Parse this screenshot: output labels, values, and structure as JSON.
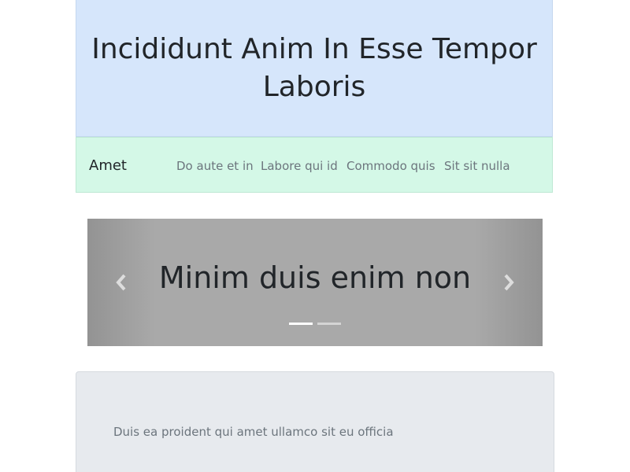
{
  "header": {
    "title": "Incididunt Anim In Esse Tempor Laboris"
  },
  "navbar": {
    "brand": "Amet",
    "items": [
      {
        "label": "Do aute et in"
      },
      {
        "label": "Labore qui id"
      },
      {
        "label": "Commodo quis"
      },
      {
        "label": "Sit sit nulla"
      }
    ]
  },
  "carousel": {
    "slide_title": "Minim duis enim non",
    "prev_icon": "chevron-left-icon",
    "next_icon": "chevron-right-icon",
    "indicator_count": 2,
    "active_indicator": 1
  },
  "jumbotron": {
    "text": "Duis ea proident qui amet ullamco sit eu officia"
  },
  "colors": {
    "header_bg": "#d6e6fb",
    "navbar_bg": "#d4f8e7",
    "carousel_bg": "#a9a9a9",
    "jumbotron_bg": "#e7eaee"
  }
}
